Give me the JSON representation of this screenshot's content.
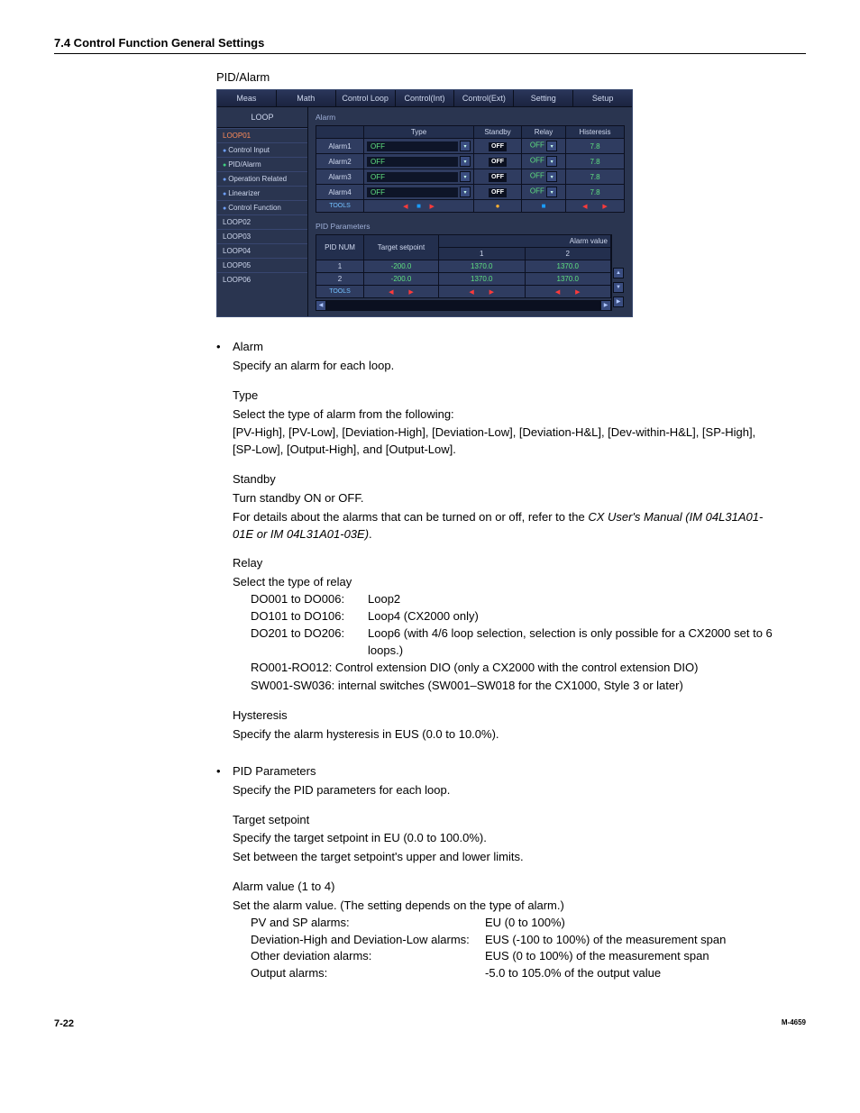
{
  "header": {
    "title": "7.4  Control Function General Settings"
  },
  "pid_alarm_title": "PID/Alarm",
  "shot": {
    "tabs": [
      "Meas",
      "Math",
      "Control Loop",
      "Control(Int)",
      "Control(Ext)",
      "Setting",
      "Setup"
    ],
    "sidebar": {
      "header": "LOOP",
      "items": [
        {
          "label": "LOOP01",
          "sel": true
        },
        {
          "label": "Control Input",
          "bulleted": true
        },
        {
          "label": "PID/Alarm",
          "bulleted": true,
          "green": true
        },
        {
          "label": "Operation Related",
          "bulleted": true
        },
        {
          "label": "Linearizer",
          "bulleted": true
        },
        {
          "label": "Control Function",
          "bulleted": true
        },
        {
          "label": "LOOP02"
        },
        {
          "label": "LOOP03"
        },
        {
          "label": "LOOP04"
        },
        {
          "label": "LOOP05"
        },
        {
          "label": "LOOP06"
        }
      ]
    },
    "alarm": {
      "group": "Alarm",
      "headers": [
        "",
        "Type",
        "Standby",
        "Relay",
        "Histeresis"
      ],
      "rows": [
        {
          "name": "Alarm1",
          "type": "OFF",
          "standby": "OFF",
          "relay": "OFF",
          "hyst": "7.8"
        },
        {
          "name": "Alarm2",
          "type": "OFF",
          "standby": "OFF",
          "relay": "OFF",
          "hyst": "7.8"
        },
        {
          "name": "Alarm3",
          "type": "OFF",
          "standby": "OFF",
          "relay": "OFF",
          "hyst": "7.8"
        },
        {
          "name": "Alarm4",
          "type": "OFF",
          "standby": "OFF",
          "relay": "OFF",
          "hyst": "7.8"
        }
      ],
      "tools": "TOOLS"
    },
    "pid": {
      "group": "PID Parameters",
      "headers": [
        "PID NUM",
        "Target setpoint",
        "1",
        "2",
        "Alarm value"
      ],
      "rows": [
        {
          "num": "1",
          "tsp": "-200.0",
          "v1": "1370.0",
          "v2": "1370.0"
        },
        {
          "num": "2",
          "tsp": "-200.0",
          "v1": "1370.0",
          "v2": "1370.0"
        }
      ],
      "tools": "TOOLS"
    }
  },
  "body": {
    "alarm_bullet": "Alarm",
    "alarm_desc": "Specify an alarm for each loop.",
    "type_h": "Type",
    "type_l1": "Select the type of alarm from the following:",
    "type_l2": "[PV-High], [PV-Low], [Deviation-High], [Deviation-Low], [Deviation-H&L], [Dev-within-H&L], [SP-High], [SP-Low], [Output-High], and [Output-Low].",
    "standby_h": "Standby",
    "standby_l1": "Turn standby ON or OFF.",
    "standby_l2a": "For details about the alarms that can be turned on or off, refer to the ",
    "standby_l2b": "CX User's Manual (IM 04L31A01-01E or IM 04L31A01-03E)",
    "standby_l2c": ".",
    "relay_h": "Relay",
    "relay_l1": "Select the type of relay",
    "relays": [
      {
        "lbl": "DO001 to DO006:",
        "val": "Loop2"
      },
      {
        "lbl": "DO101 to DO106:",
        "val": "Loop4 (CX2000 only)"
      },
      {
        "lbl": "DO201 to DO206:",
        "val": "Loop6 (with 4/6 loop selection, selection is only possible for a CX2000 set to 6 loops.)"
      },
      {
        "lbl": "RO001-RO012:",
        "val": "Control extension DIO (only a CX2000 with the control extension DIO)",
        "wrap": true
      }
    ],
    "relay_sw": "SW001-SW036: internal switches (SW001–SW018 for the CX1000, Style 3 or later)",
    "hyst_h": "Hysteresis",
    "hyst_l1": "Specify the alarm hysteresis in EUS (0.0 to 10.0%).",
    "pid_bullet": "PID Parameters",
    "pid_desc": "Specify the PID parameters for each loop.",
    "tsp_h": "Target setpoint",
    "tsp_l1": "Specify the target setpoint in EU (0.0 to 100.0%).",
    "tsp_l2": "Set between the target setpoint's upper and lower limits.",
    "av_h": "Alarm value (1 to 4)",
    "av_l1": "Set the alarm value.  (The setting depends on the type of alarm.)",
    "av_rows": [
      {
        "l": "PV and SP alarms:",
        "r": "EU (0 to 100%)"
      },
      {
        "l": "Deviation-High and Deviation-Low alarms:",
        "r": "EUS (-100 to 100%) of the measurement span"
      },
      {
        "l": "Other deviation alarms:",
        "r": "EUS (0 to 100%) of the measurement span"
      },
      {
        "l": "Output alarms:",
        "r": "-5.0 to 105.0% of the output value"
      }
    ]
  },
  "footer": {
    "page": "7-22",
    "manual": "M-4659"
  }
}
